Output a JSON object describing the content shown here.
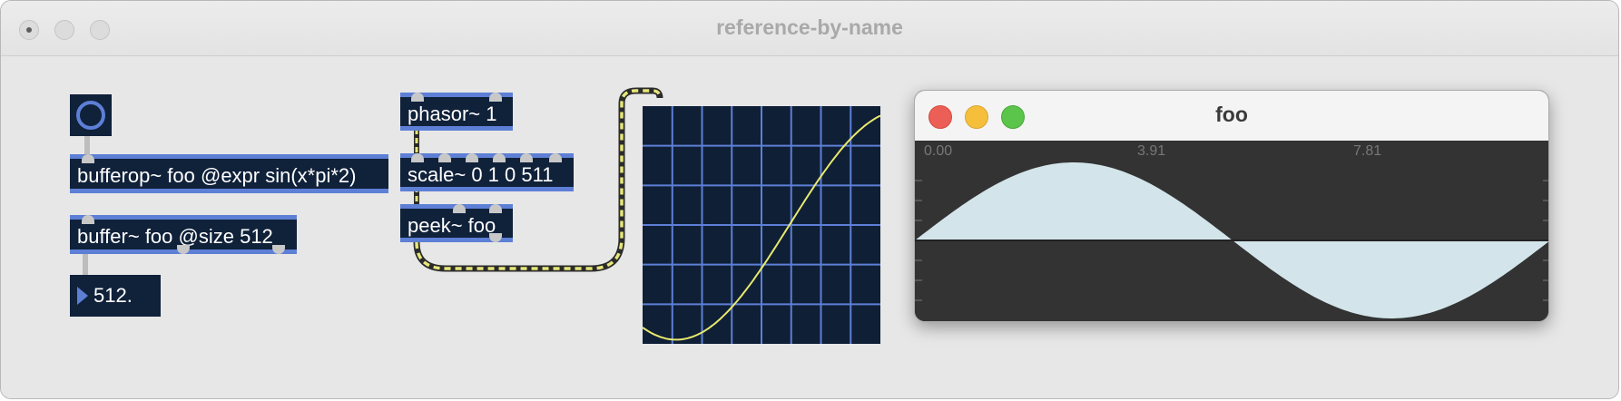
{
  "window": {
    "title": "reference-by-name"
  },
  "objects": {
    "bufferop": "bufferop~ foo @expr sin(x*pi*2)",
    "buffer": "buffer~ foo @size 512",
    "number_value": "512.",
    "phasor": "phasor~ 1",
    "scale": "scale~ 0 1 0 511",
    "peek": "peek~ foo"
  },
  "buffer_window": {
    "title": "foo",
    "ruler": [
      "0.00",
      "3.91",
      "7.81"
    ],
    "waveform_color": "#d3e5ea"
  },
  "colors": {
    "object_bg": "#10213a",
    "accent": "#5d7fd6",
    "patch_cord": "#e6e67a",
    "scope_line": "#e8e870"
  },
  "icons": {
    "toggle": "toggle-ring-icon",
    "number": "number-triangle-icon"
  }
}
